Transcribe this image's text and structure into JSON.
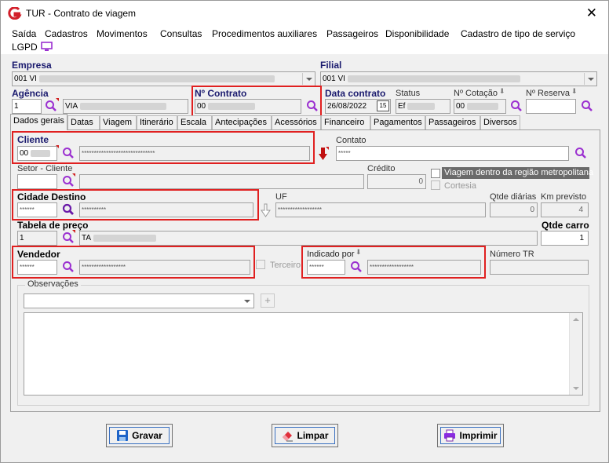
{
  "window": {
    "title": "TUR - Contrato de viagem",
    "close_glyph": "✕"
  },
  "menu": [
    "Saída",
    "Cadastros",
    "Movimentos",
    "Consultas",
    "Procedimentos auxiliares",
    "Passageiros",
    "Disponibilidade",
    "Cadastro de tipo de serviço",
    "LGPD"
  ],
  "header": {
    "empresa_label": "Empresa",
    "empresa_value": "001 VI",
    "filial_label": "Filial",
    "filial_value": "001 VI",
    "agencia_label": "Agência",
    "agencia_value": "1",
    "agencia_desc": "VIA",
    "contrato_label": "Nº Contrato",
    "contrato_value": "00",
    "data_label": "Data contrato",
    "data_value": "26/08/2022",
    "status_label": "Status",
    "status_value": "Ef",
    "cotacao_label": "Nº Cotação",
    "cotacao_value": "00",
    "reserva_label": "Nº Reserva"
  },
  "tabs": [
    "Dados gerais",
    "Datas",
    "Viagem",
    "Itinerário",
    "Escala",
    "Antecipações",
    "Acessórios",
    "Financeiro",
    "Pagamentos",
    "Passageiros",
    "Diversos"
  ],
  "form": {
    "cliente_label": "Cliente",
    "cliente_value": "00",
    "cliente_desc": "******************************",
    "contato_label": "Contato",
    "contato_value": "*****",
    "setor_label": "Setor - Cliente",
    "credito_label": "Crédito",
    "credito_value": "0",
    "metro_label": "Viagem dentro da região metropolitana",
    "cortesia_label": "Cortesia",
    "cidade_label": "Cidade Destino",
    "cidade_value": "******",
    "cidade_desc": "**********",
    "uf_label": "UF",
    "uf_value": "******************",
    "qtde_diarias_label": "Qtde diárias",
    "qtde_diarias_value": "0",
    "km_label": "Km previsto",
    "km_value": "4",
    "tabela_label": "Tabela de preço",
    "tabela_value": "1",
    "tabela_desc": "TA",
    "qtde_carro_label": "Qtde carro",
    "qtde_carro_value": "1",
    "vendedor_label": "Vendedor",
    "vendedor_value": "******",
    "vendedor_desc": "******************",
    "terceiro_label": "Terceiro",
    "indicado_label": "Indicado por",
    "indicado_value": "******",
    "indicado_desc": "******************",
    "numero_tr_label": "Número TR",
    "observacoes_label": "Observações"
  },
  "buttons": {
    "gravar": "Gravar",
    "limpar": "Limpar",
    "imprimir": "Imprimir"
  },
  "colors": {
    "highlight": "#e02020",
    "accent": "#8a2be2",
    "label_navy": "#1a1a6e"
  }
}
